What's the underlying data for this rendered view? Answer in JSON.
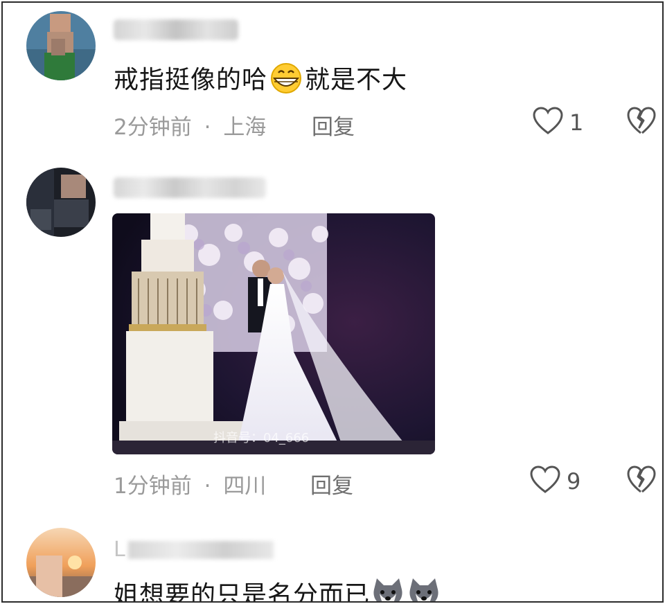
{
  "comments": [
    {
      "text_before_emoji": "戒指挺像的哈",
      "emoji": "grinning-face-emoji",
      "text_after_emoji": "就是不大",
      "time": "2分钟前",
      "location": "上海",
      "reply_label": "回复",
      "likes": "1"
    },
    {
      "image_watermark": "抖音号：04_666",
      "time": "1分钟前",
      "location": "四川",
      "reply_label": "回复",
      "likes": "9"
    },
    {
      "username_partial": "L",
      "text": "姐想要的只是名分而已",
      "emoji": "dog-face-emoji"
    }
  ],
  "separator": "·",
  "colors": {
    "text": "#161616",
    "meta": "#9a9a9a",
    "icon": "#555555",
    "border": "#2b2b2b"
  }
}
